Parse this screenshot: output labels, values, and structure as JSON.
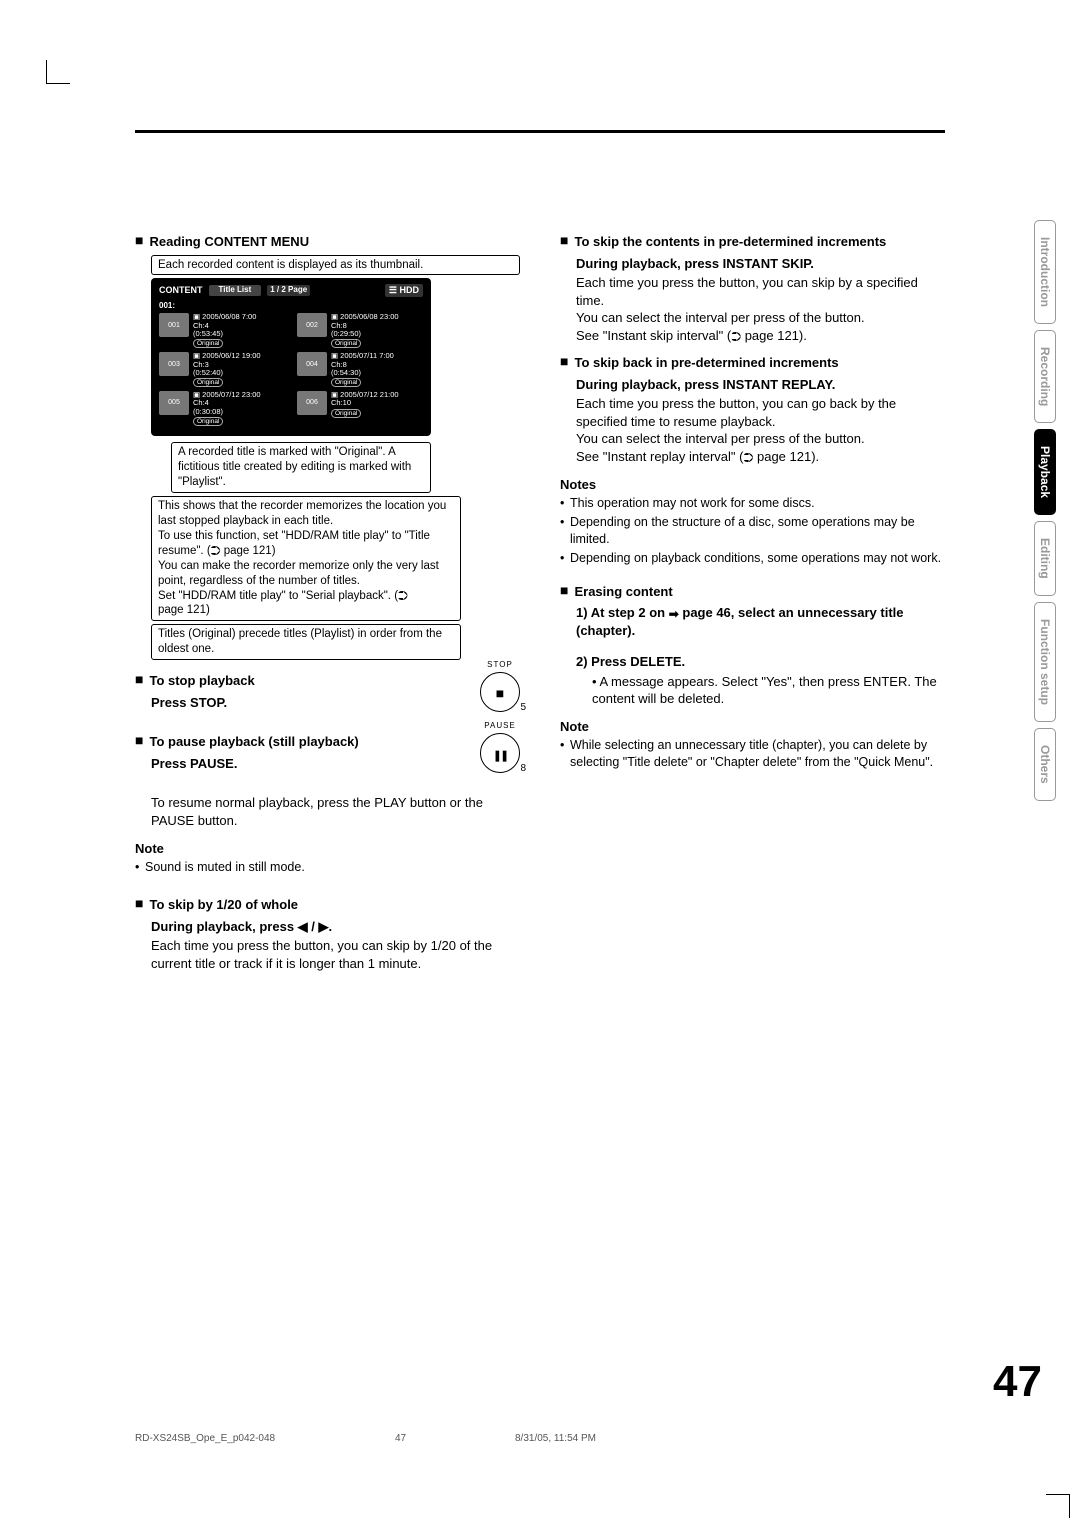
{
  "page_number": "47",
  "sidetabs": [
    "Introduction",
    "Recording",
    "Playback",
    "Editing",
    "Function setup",
    "Others"
  ],
  "sidetab_active_index": 2,
  "footer": {
    "left": "RD-XS24SB_Ope_E_p042-048",
    "mid": "47",
    "right": "8/31/05, 11:54 PM"
  },
  "left": {
    "heading1": "Reading CONTENT MENU",
    "callout_top": "Each recorded content is displayed as its thumbnail.",
    "content_menu": {
      "label_left": "CONTENT",
      "label_titlelist": "Title List",
      "label_page": "1 / 2  Page",
      "label_hdd": "HDD",
      "row001": "001:",
      "items": [
        {
          "n": "001",
          "date": "2005/06/08  7:00",
          "ch": "Ch:4",
          "dur": "(0:53:45)",
          "tag": "Original"
        },
        {
          "n": "002",
          "date": "2005/06/08 23:00",
          "ch": "Ch:8",
          "dur": "(0:29:50)",
          "tag": "Original"
        },
        {
          "n": "003",
          "date": "2005/06/12 19:00",
          "ch": "Ch:3",
          "dur": "(0:52:40)",
          "tag": "Original"
        },
        {
          "n": "004",
          "date": "2005/07/11  7:00",
          "ch": "Ch:8",
          "dur": "(0:54:30)",
          "tag": "Original"
        },
        {
          "n": "005",
          "date": "2005/07/12 23:00",
          "ch": "Ch:4",
          "dur": "(0:30:08)",
          "tag": "Original"
        },
        {
          "n": "006",
          "date": "2005/07/12 21:00",
          "ch": "Ch:10",
          "dur": "",
          "tag": "Original"
        }
      ]
    },
    "callout_mid": "A recorded title is marked with \"Original\". A fictitious title created by editing is marked with \"Playlist\".",
    "callout_resume_1": "This shows that the recorder memorizes the location you last stopped playback in each title.",
    "callout_resume_2": "To use this function, set \"HDD/RAM title play\" to \"Title resume\". (",
    "callout_resume_3": " page 121)",
    "callout_resume_4": "You can make the recorder memorize only the very last point, regardless of the number of titles.",
    "callout_resume_5": "Set \"HDD/RAM title play\" to \"Serial playback\". (",
    "callout_resume_6": " page 121)",
    "callout_order": "Titles (Original) precede titles (Playlist) in order from the oldest one.",
    "stop_head": "To stop playback",
    "stop_sub": "Press STOP.",
    "stop_btn_top": "STOP",
    "stop_btn_sub": "5",
    "pause_head": "To pause playback (still playback)",
    "pause_sub": "Press PAUSE.",
    "pause_btn_top": "PAUSE",
    "pause_btn_sub": "8",
    "pause_body": "To resume normal playback, press the PLAY button or the PAUSE button.",
    "note1_h": "Note",
    "note1_b": "Sound is muted in still mode.",
    "skip120_head": "To skip by 1/20 of whole",
    "skip120_sub": "During playback, press ◀ / ▶.",
    "skip120_body": "Each time you press the button, you can skip by 1/20 of the current title or track if it is longer than 1 minute."
  },
  "right": {
    "skipfwd_head": "To skip the contents in pre-determined increments",
    "skipfwd_sub": "During playback, press INSTANT SKIP.",
    "skipfwd_b1": "Each time you press the button, you can skip by a specified time.",
    "skipfwd_b2": "You can select the interval per press of the button.",
    "skipfwd_b3a": "See \"Instant skip interval\" (",
    "skipfwd_b3b": " page 121).",
    "skipback_head": "To skip back in pre-determined increments",
    "skipback_sub": "During playback, press INSTANT REPLAY.",
    "skipback_b1": "Each time you press the button, you can go back by the specified time to resume playback.",
    "skipback_b2": "You can select the interval per press of the button.",
    "skipback_b3a": "See \"Instant replay interval\" (",
    "skipback_b3b": " page 121).",
    "notes_h": "Notes",
    "notes": [
      "This operation may not work for some discs.",
      "Depending on the structure of a disc, some operations may be limited.",
      "Depending on playback conditions, some operations may not work."
    ],
    "erase_head": "Erasing content",
    "erase_s1a": "1)  At step 2 on ",
    "erase_s1b": " page 46, select an unnecessary title (chapter).",
    "erase_s2": "2)  Press DELETE.",
    "erase_s2b": "A message appears. Select \"Yes\", then press ENTER. The content will be deleted.",
    "note2_h": "Note",
    "note2_b": "While selecting an unnecessary title (chapter), you can delete by selecting \"Title delete\" or \"Chapter delete\" from the \"Quick Menu\"."
  }
}
